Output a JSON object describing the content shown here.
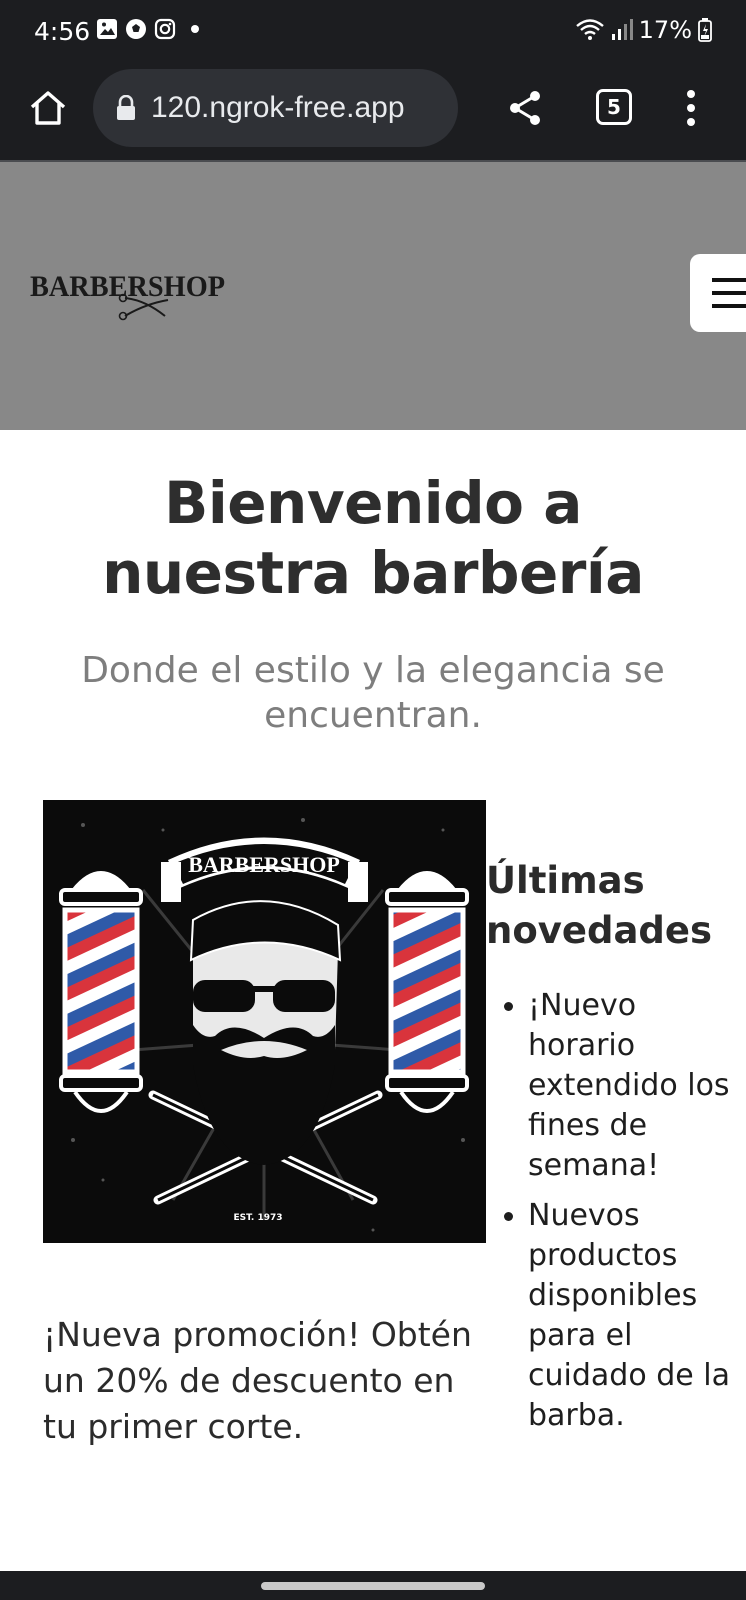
{
  "status_bar": {
    "time": "4:56",
    "battery": "17%",
    "icons": [
      "image-icon",
      "soccer-ball-icon",
      "instagram-icon",
      "wifi-icon",
      "signal-icon",
      "battery-icon"
    ]
  },
  "browser": {
    "url": "120.ngrok-free.app",
    "tab_count": "5",
    "icons": [
      "home-icon",
      "lock-icon",
      "share-icon",
      "more-vert-icon"
    ]
  },
  "site": {
    "logo_text": "BARBERSHOP",
    "hero_title": "Bienvenido a nuestra barbería",
    "hero_subtitle": "Donde el estilo y la elegancia se encuentran.",
    "promo_image": {
      "banner_text": "BARBERSHOP",
      "est_text": "EST. 1973"
    },
    "promo_text": "¡Nueva promoción! Obtén un 20% de descuento en tu primer corte.",
    "news": {
      "title": "Últimas novedades",
      "items": [
        "¡Nuevo horario extendido los fines de semana!",
        "Nuevos productos disponibles para el cuidado de la barba."
      ]
    }
  },
  "colors": {
    "header_bg": "#888888",
    "browser_bg": "#1c1d20",
    "url_pill": "#2f3136",
    "title_text": "#2e2e2e",
    "subtitle_text": "#7e7e7e",
    "pole_red": "#d9343c",
    "pole_blue": "#2f5aa8"
  }
}
